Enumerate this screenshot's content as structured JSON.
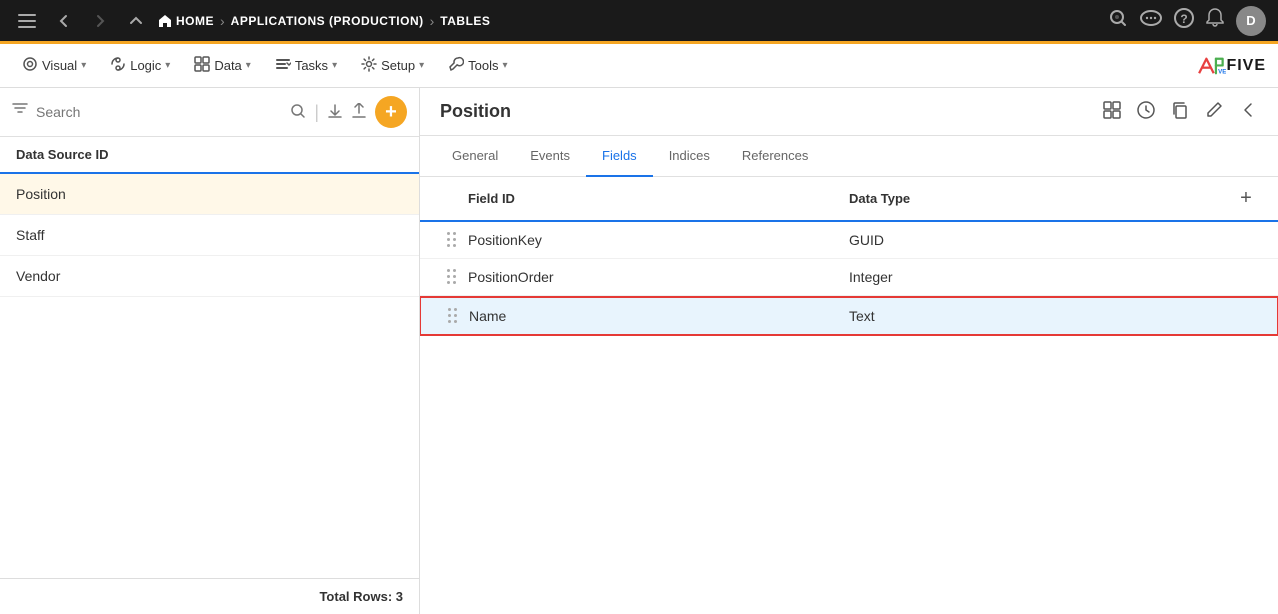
{
  "topNav": {
    "hamburger_label": "☰",
    "back_label": "←",
    "forward_label": "→",
    "up_label": "↑",
    "home_label": "⌂",
    "breadcrumbs": [
      {
        "id": "home",
        "label": "HOME"
      },
      {
        "id": "applications",
        "label": "APPLICATIONS (PRODUCTION)"
      },
      {
        "id": "tables",
        "label": "TABLES"
      }
    ],
    "search_icon": "🔍",
    "chat_icon": "💬",
    "help_icon": "?",
    "bell_icon": "🔔",
    "avatar_label": "D"
  },
  "secondNav": {
    "menus": [
      {
        "id": "visual",
        "label": "Visual",
        "icon": "👁"
      },
      {
        "id": "logic",
        "label": "Logic",
        "icon": "⚙"
      },
      {
        "id": "data",
        "label": "Data",
        "icon": "⊞"
      },
      {
        "id": "tasks",
        "label": "Tasks",
        "icon": "✔"
      },
      {
        "id": "setup",
        "label": "Setup",
        "icon": "⚙"
      },
      {
        "id": "tools",
        "label": "Tools",
        "icon": "🔧"
      }
    ],
    "logo_text": "FIVE"
  },
  "sidebar": {
    "header_label": "Data Source ID",
    "search_placeholder": "Search",
    "items": [
      {
        "id": "position",
        "label": "Position",
        "active": true
      },
      {
        "id": "staff",
        "label": "Staff",
        "active": false
      },
      {
        "id": "vendor",
        "label": "Vendor",
        "active": false
      }
    ],
    "footer_label": "Total Rows: 3"
  },
  "content": {
    "title": "Position",
    "tabs": [
      {
        "id": "general",
        "label": "General",
        "active": false
      },
      {
        "id": "events",
        "label": "Events",
        "active": false
      },
      {
        "id": "fields",
        "label": "Fields",
        "active": true
      },
      {
        "id": "indices",
        "label": "Indices",
        "active": false
      },
      {
        "id": "references",
        "label": "References",
        "active": false
      }
    ],
    "table": {
      "col_field": "Field ID",
      "col_type": "Data Type",
      "rows": [
        {
          "id": "positionkey",
          "field": "PositionKey",
          "type": "GUID",
          "selected": false
        },
        {
          "id": "positionorder",
          "field": "PositionOrder",
          "type": "Integer",
          "selected": false
        },
        {
          "id": "name",
          "field": "Name",
          "type": "Text",
          "selected": true
        }
      ]
    }
  },
  "colors": {
    "accent": "#f5a623",
    "primary": "#1a73e8",
    "selected_border": "#e53935",
    "selected_bg": "#e8f4fd",
    "active_sidebar": "#fff8e8"
  }
}
